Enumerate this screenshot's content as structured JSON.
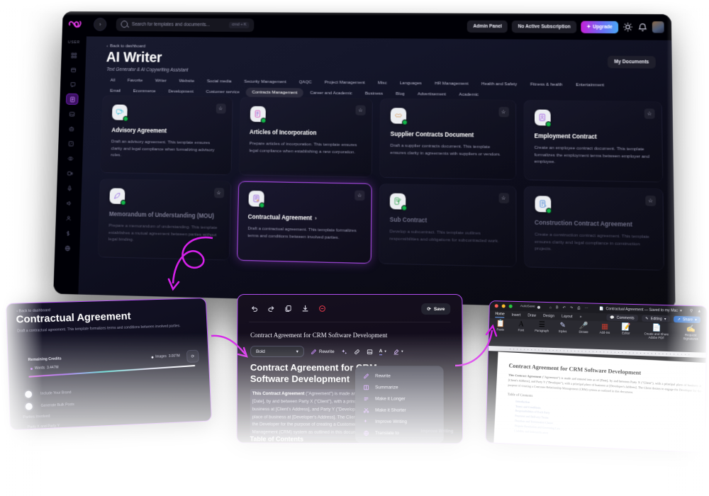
{
  "topbar": {
    "logo_name": "brand-logo",
    "search_placeholder": "Search for templates and documents...",
    "search_shortcut": "cmd + K",
    "admin_panel": "Admin Panel",
    "subscription": "No Active Subscription",
    "upgrade": "Upgrade",
    "theme_icon": "sun-icon",
    "bell_icon": "bell-icon"
  },
  "sidebar": {
    "section_label": "USER",
    "items": [
      {
        "name": "dashboard-grid",
        "icon": "grid-icon"
      },
      {
        "name": "inbox",
        "icon": "tray-icon"
      },
      {
        "name": "chat",
        "icon": "chat-icon"
      },
      {
        "name": "ai-writer",
        "icon": "document-text-icon",
        "active": true
      },
      {
        "name": "ai-image",
        "icon": "image-icon"
      },
      {
        "name": "ai-bot",
        "icon": "robot-icon"
      },
      {
        "name": "ai-editor",
        "icon": "pencil-square-icon"
      },
      {
        "name": "ai-vision",
        "icon": "eye-icon"
      },
      {
        "name": "ai-video",
        "icon": "video-icon"
      },
      {
        "name": "ai-voice",
        "icon": "microphone-icon"
      },
      {
        "name": "ai-speech",
        "icon": "speaker-icon"
      },
      {
        "name": "ai-agent",
        "icon": "user-icon"
      },
      {
        "name": "billing",
        "icon": "dollar-icon"
      },
      {
        "name": "integrations",
        "icon": "globe-icon"
      }
    ]
  },
  "page": {
    "back_link": "Back to dashboard",
    "title": "AI Writer",
    "subtitle": "Text Generator & AI Copywriting Assistant",
    "my_documents": "My Documents"
  },
  "tabs": {
    "active": "Contracts Management",
    "row1": [
      "All",
      "Favorite",
      "Writer",
      "Website",
      "Social media",
      "Security Management",
      "QAQC",
      "Project Management",
      "Misc",
      "Languages",
      "HR Management",
      "Health and Safety",
      "Fitness & health",
      "Entertainment"
    ],
    "row2": [
      "Email",
      "Ecommerce",
      "Development",
      "Customer service",
      "Contracts Management",
      "Career and Academic",
      "Business",
      "Blog",
      "Advertisement",
      "Academic"
    ]
  },
  "cards": [
    {
      "title": "Advisory Agreement",
      "desc": "Draft an advisory agreement. This template ensures clarity and legal compliance when formalizing advisory roles.",
      "icon": "speech-bubble-icon",
      "state": "normal"
    },
    {
      "title": "Articles of Incorporation",
      "desc": "Prepare articles of incorporation. This template ensures legal compliance when establishing a new corporation.",
      "icon": "document-edit-icon",
      "state": "normal"
    },
    {
      "title": "Supplier Contracts Document",
      "desc": "Draft a supplier contracts document. This template ensures clarity in agreements with suppliers or vendors.",
      "icon": "handshake-icon",
      "state": "normal"
    },
    {
      "title": "Employment Contract",
      "desc": "Create an employee contract document. This template formalizes the employment terms between employer and employee.",
      "icon": "person-document-icon",
      "state": "normal"
    },
    {
      "title": "Memorandum of Understanding (MOU)",
      "desc": "Prepare a memorandum of understanding. This template establishes a mutual agreement between parties without legal binding.",
      "icon": "feather-pen-icon",
      "state": "dim"
    },
    {
      "title": "Contractual Agreement",
      "desc": "Draft a contractual agreement. This template formalizes terms and conditions between involved parties.",
      "icon": "contract-icon",
      "state": "selected",
      "chevron": "›"
    },
    {
      "title": "Sub Contract",
      "desc": "Develop a subcontract. This template outlines responsibilities and obligations for subcontracted work.",
      "icon": "document-pen-icon",
      "state": "dim2"
    },
    {
      "title": "Construction Contract Agreement",
      "desc": "Create a construction contract agreement. This template ensures clarity and legal compliance in construction projects.",
      "icon": "blueprint-icon",
      "state": "dim2"
    }
  ],
  "panel_form": {
    "back_link": "Back to dashboard",
    "title": "Contractual Agreement",
    "subtitle": "Draft a contractual agreement. This template formalizes terms and conditions between involved parties.",
    "credits_label": "Remaining Credits",
    "words_label": "Words",
    "words_value": "3.447M",
    "images_label": "Images",
    "images_value": "3.00?M",
    "refresh_icon": "refresh-icon",
    "toggle_brand": "Include Your Brand",
    "toggle_bulk": "Generate Bulk Posts",
    "section_parties": "Parties Involved",
    "field_parties": "Party X and Party Y"
  },
  "panel_editor": {
    "tools": [
      "undo-icon",
      "redo-icon",
      "copy-icon",
      "download-icon",
      "clear-icon"
    ],
    "save_label": "Save",
    "doc_title": "Contract Agreement for CRM Software Development",
    "format_select": "Bold",
    "rewrite_label": "Rewrite",
    "toolbar_icons": [
      "ai-sparkle-icon",
      "link-icon",
      "image-icon",
      "text-color-icon",
      "highlight-icon"
    ],
    "heading": "Contract Agreement for CRM Software Development",
    "body_lead": "This Contract Agreement",
    "body_text": " (\"Agreement\") is made and entered into as of [Date], by and between Party X (\"Client\"), with a principal place of business at [Client's Address], and Party Y (\"Developer\"), with a principal place of business at [Developer's Address]. The Client desires to engage the Developer for the purpose of creating a Customer Relationship Management (CRM) system as outlined in this document.",
    "toc_heading": "Table of Contents",
    "menu": [
      {
        "label": "Rewrite",
        "icon": "pencil-icon"
      },
      {
        "label": "Summarize",
        "icon": "book-icon"
      },
      {
        "label": "Make it Longer",
        "icon": "expand-icon"
      },
      {
        "label": "Make it Shorter",
        "icon": "scissors-icon"
      },
      {
        "label": "Improve Writing",
        "icon": "sparkle-icon"
      },
      {
        "label": "Translate to",
        "icon": "globe-icon"
      }
    ],
    "tooltip": "Improve Writing"
  },
  "panel_word": {
    "autosave": "AutoSave",
    "filename": "Contractual Agreement — Saved to my Mac",
    "tabs": [
      "Home",
      "Insert",
      "Draw",
      "Design",
      "Layout"
    ],
    "tab_more": "»",
    "comments": "Comments",
    "editing": "Editing",
    "share": "Share",
    "ribbon": [
      {
        "label": "Paste",
        "icon": "clipboard-icon"
      },
      {
        "label": "Font",
        "icon": "font-icon"
      },
      {
        "label": "Paragraph",
        "icon": "paragraph-icon"
      },
      {
        "label": "Styles",
        "icon": "styles-icon"
      },
      {
        "label": "Dictate",
        "icon": "microphone-icon"
      },
      {
        "label": "Add-ins",
        "icon": "addins-icon"
      },
      {
        "label": "Editor",
        "icon": "editor-icon"
      },
      {
        "label": "Create and Share Adobe PDF",
        "icon": "pdf-icon"
      },
      {
        "label": "Request Signatures",
        "icon": "signature-icon"
      }
    ],
    "doc_heading": "Contract Agreement for CRM Software Development",
    "doc_lead": "This Contract Agreement",
    "doc_body": " (\"Agreement\") is made and entered into as of [Date], by and between Party X (\"Client\"), with a principal place of business at [Client's Address], and Party Y (\"Developer\"), with a principal place of business at [Developer's Address]. The Client desires to engage the Developer for the purpose of creating a Customer Relationship Management (CRM) system as outlined in this document.",
    "toc_heading": "Table of Contents",
    "toc": [
      "Introduction",
      "Terms and Conditions",
      "Responsibilities of Each Party",
      "Payment and Delivery Terms",
      "Duration and Termination Clause",
      "Dispute Resolution and Governing Law",
      "Liability and Indemnification"
    ]
  },
  "colors": {
    "accent_purple": "#b14ef0",
    "accent_magenta": "#c520d8",
    "blue": "#49a8f5",
    "online_green": "#12b64a",
    "danger_red": "#e0394a"
  }
}
